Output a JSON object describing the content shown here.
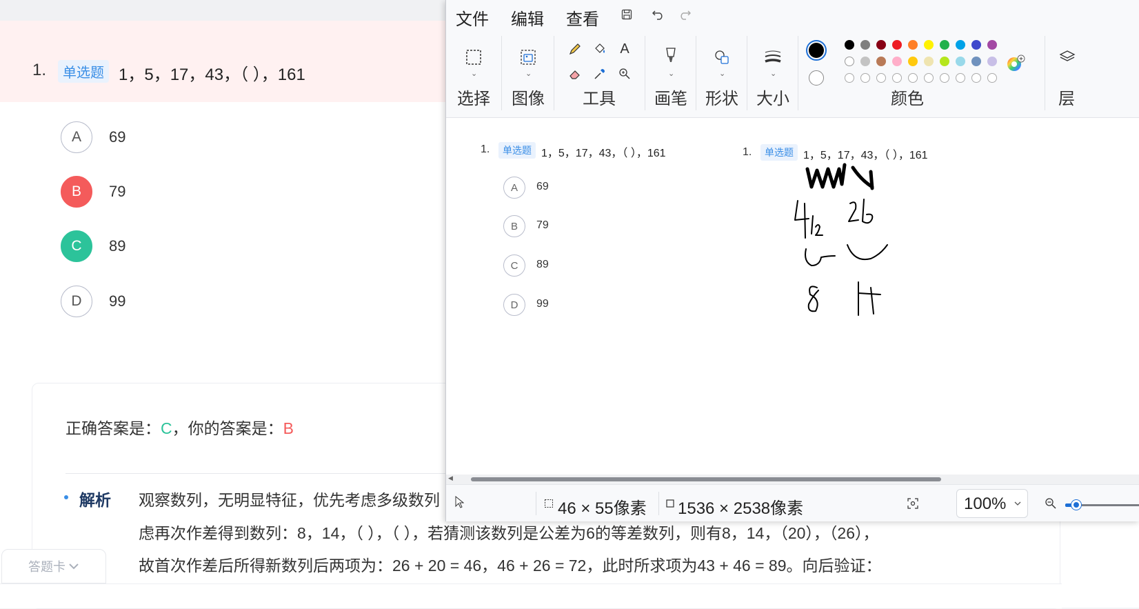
{
  "quiz": {
    "number": "1.",
    "type_tag": "单选题",
    "question": "1，5，17，43，（ ），161",
    "options": [
      {
        "letter": "A",
        "value": "69",
        "state": "normal"
      },
      {
        "letter": "B",
        "value": "79",
        "state": "wrong"
      },
      {
        "letter": "C",
        "value": "89",
        "state": "correct"
      },
      {
        "letter": "D",
        "value": "99",
        "state": "normal"
      }
    ],
    "answer": {
      "correct_prefix": "正确答案是：",
      "correct_value": "C",
      "mine_prefix": "，你的答案是：",
      "mine_value": "B"
    },
    "analysis_label": "解析",
    "analysis_lines": [
      "观察数列，无明显特征，优先考虑多级数列",
      "虑再次作差得到数列：8，14，（ ），（ ），若猜测该数列是公差为6的等差数列，则有8，14，（20），（26），",
      "故首次作差后所得新数列后两项为：26 + 20 = 46，46 + 26 = 72，此时所求项为43 + 46 = 89。向后验证："
    ],
    "card_tab": "答题卡"
  },
  "paint": {
    "menu": [
      "文件",
      "编辑",
      "查看"
    ],
    "groups": {
      "select": "选择",
      "image": "图像",
      "tools": "工具",
      "brush": "画笔",
      "shapes": "形状",
      "size": "大小",
      "colors": "颜色",
      "layers": "层"
    },
    "palette_row1": [
      "#000000",
      "#7f7f7f",
      "#880015",
      "#ed1c24",
      "#ff7f27",
      "#fff200",
      "#22b14c",
      "#00a2e8",
      "#3f48cc",
      "#a349a4"
    ],
    "palette_row2": [
      "#ffffff",
      "#c3c3c3",
      "#b97a57",
      "#ffaec9",
      "#ffc90e",
      "#efe4b0",
      "#b5e61d",
      "#99d9ea",
      "#7092be",
      "#c8bfe7"
    ],
    "primary_color": "#000000",
    "secondary_color": "#ffffff",
    "status": {
      "selection_size": "46 × 55像素",
      "canvas_size": "1536 × 2538像素",
      "zoom": "100%"
    },
    "zoom_level": 0.15,
    "canvas": {
      "left_copy": {
        "number": "1.",
        "tag": "单选题",
        "question": "1，5，17，43，（ ），161",
        "options": [
          {
            "letter": "A",
            "value": "69"
          },
          {
            "letter": "B",
            "value": "79"
          },
          {
            "letter": "C",
            "value": "89"
          },
          {
            "letter": "D",
            "value": "99"
          }
        ]
      },
      "right_copy": {
        "number": "1.",
        "tag": "单选题",
        "question": "1，5，17，43，（ ），161"
      }
    }
  }
}
